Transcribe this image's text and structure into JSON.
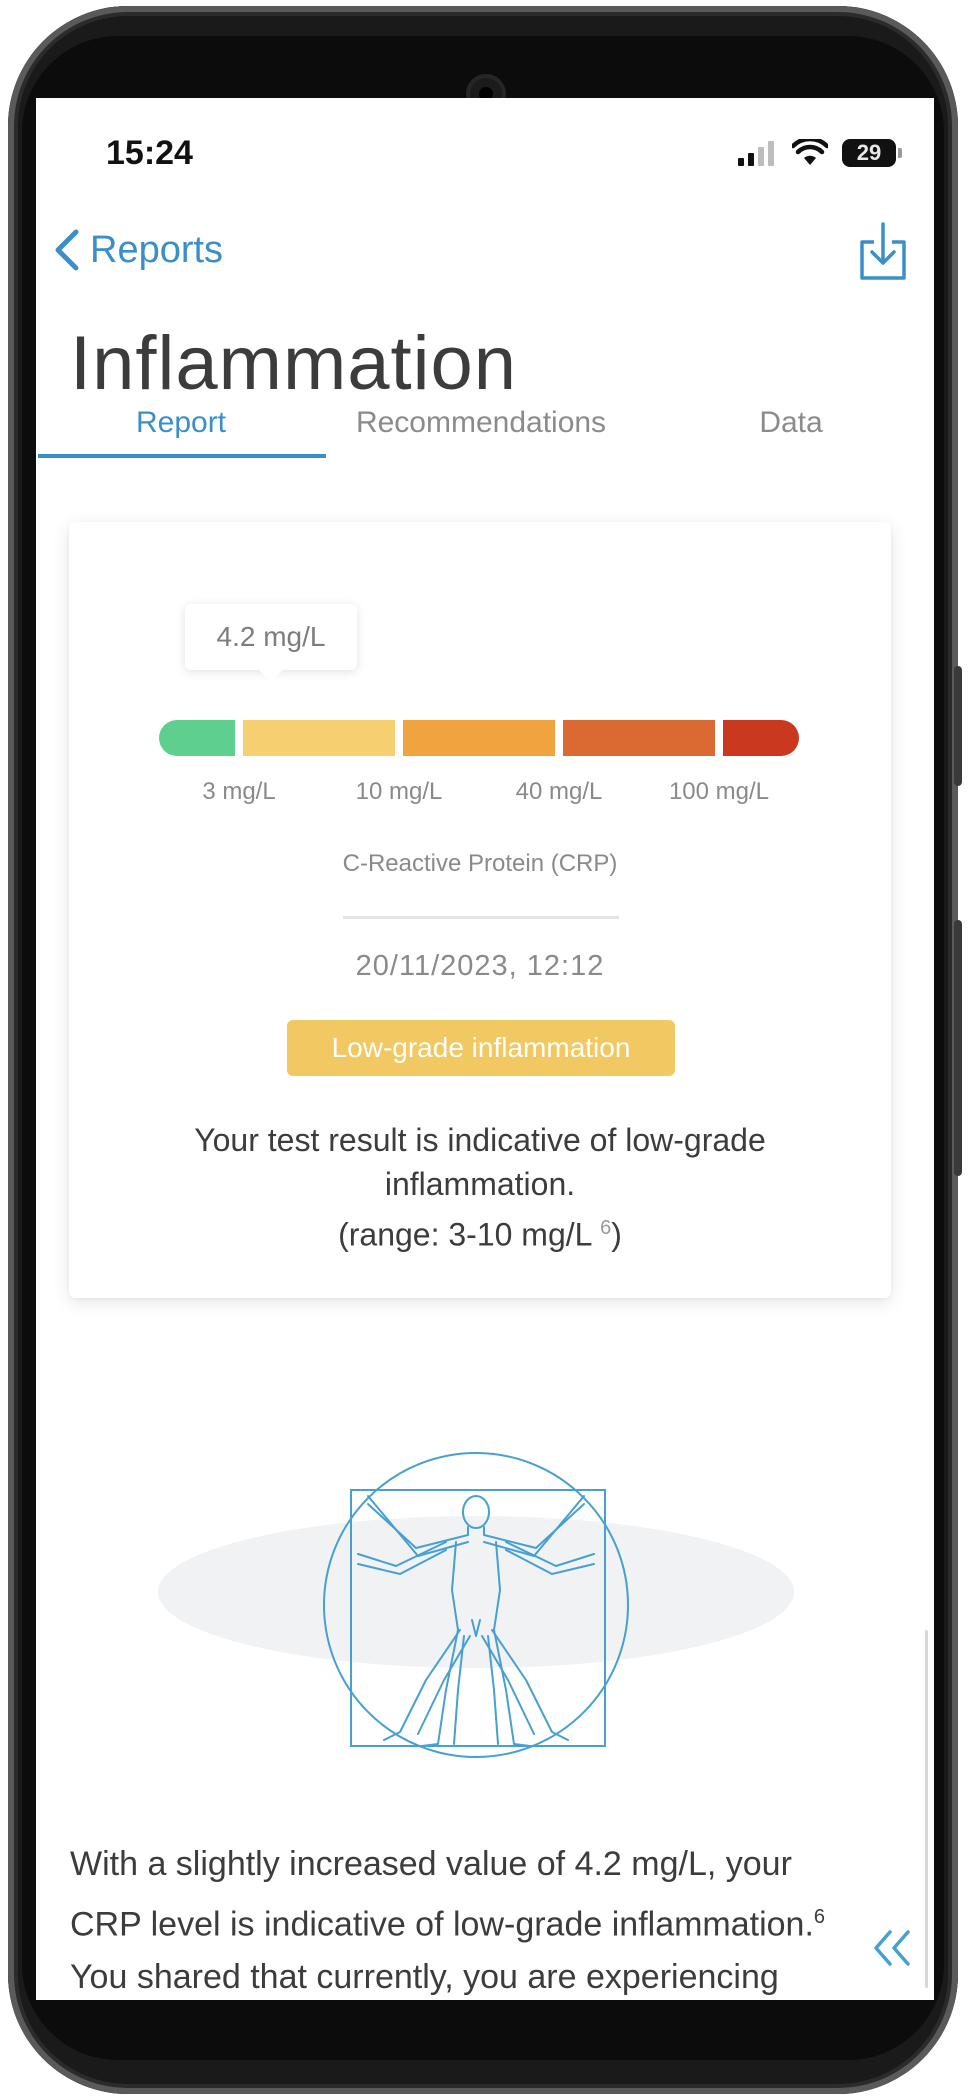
{
  "status_bar": {
    "time": "15:24",
    "battery": "29"
  },
  "nav": {
    "back_label": "Reports"
  },
  "page": {
    "title": "Inflammation"
  },
  "tabs": [
    {
      "label": "Report",
      "active": true
    },
    {
      "label": "Recommendations",
      "active": false
    },
    {
      "label": "Data",
      "active": false
    }
  ],
  "card": {
    "value_label": "4.2 mg/L",
    "scale_segments": [
      {
        "color": "#5ecf8f"
      },
      {
        "color": "#f6cf70"
      },
      {
        "color": "#f0a33e"
      },
      {
        "color": "#db6a32"
      },
      {
        "color": "#c9381f"
      }
    ],
    "thresholds": [
      "3 mg/L",
      "10 mg/L",
      "40 mg/L",
      "100 mg/L"
    ],
    "biomarker": "C-Reactive Protein (CRP)",
    "timestamp": "20/11/2023, 12:12",
    "status": "Low-grade inflammation",
    "status_color": "#f2c862",
    "result_line1": "Your test result is indicative of low-grade inflammation.",
    "result_line2": "(range: 3-10 mg/L",
    "result_ref": "6",
    "result_close": ")"
  },
  "body": {
    "line1": "With a slightly increased value of 4.2 mg/L, your",
    "line2": "CRP level is indicative of low-grade inflammation.",
    "line2_ref": "6",
    "line3": "You shared that currently, you are experiencing"
  },
  "colors": {
    "accent": "#3a8fc8",
    "title": "#3c3c3c"
  }
}
